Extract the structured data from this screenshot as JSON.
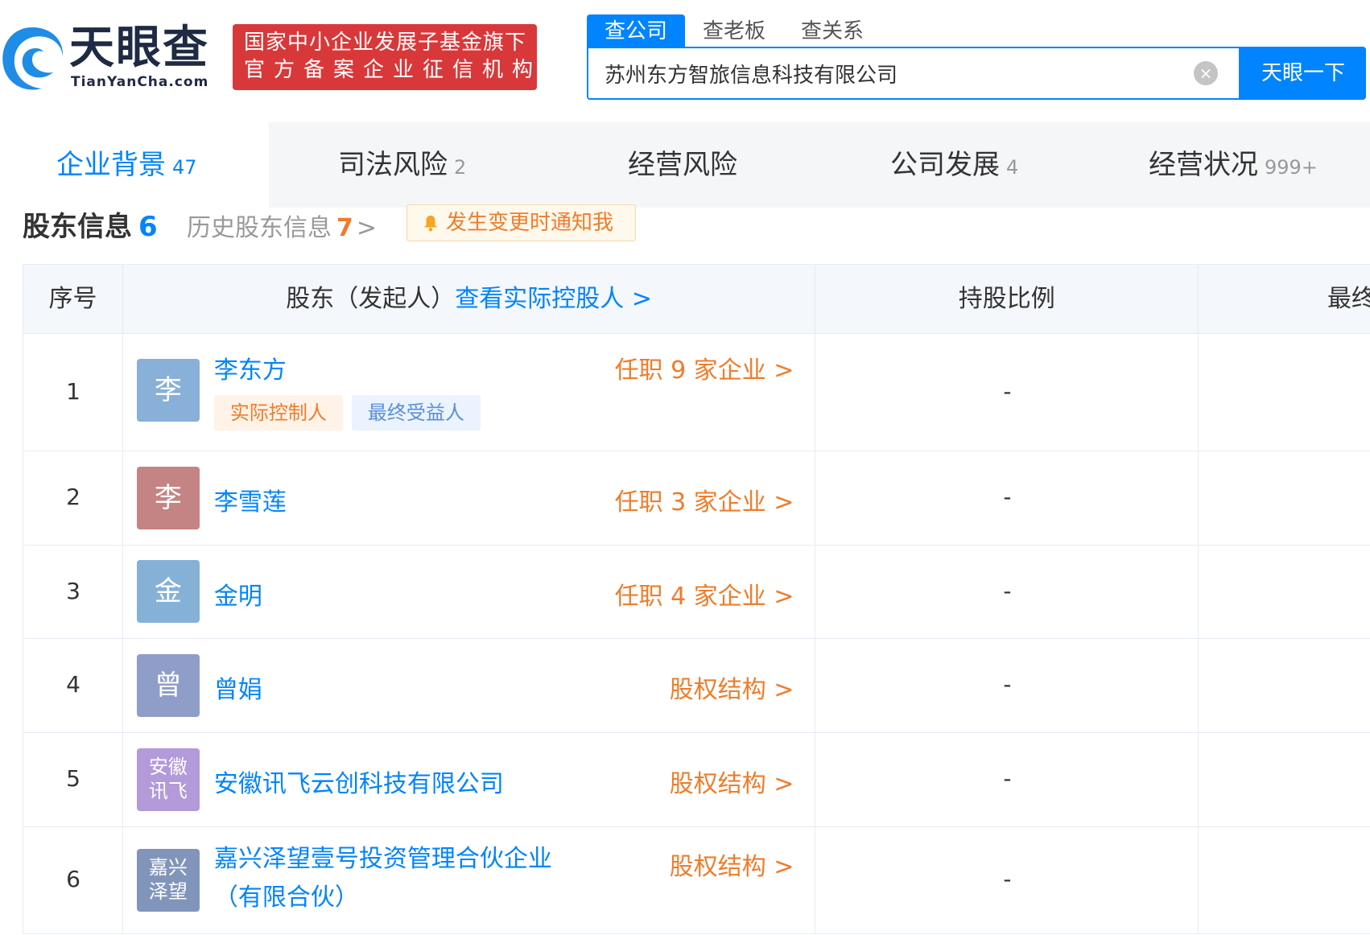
{
  "header": {
    "logo_text": "天眼查",
    "logo_sub": "TianYanCha.com",
    "badge_line1": "国家中小企业发展子基金旗下",
    "badge_line2": "官方备案企业征信机构",
    "search_tabs": [
      "查公司",
      "查老板",
      "查关系"
    ],
    "search_value": "苏州东方智旅信息科技有限公司",
    "search_button": "天眼一下",
    "clear_icon": "×"
  },
  "nav": [
    {
      "label": "企业背景",
      "count": "47"
    },
    {
      "label": "司法风险",
      "count": "2"
    },
    {
      "label": "经营风险",
      "count": ""
    },
    {
      "label": "公司发展",
      "count": "4"
    },
    {
      "label": "经营状况",
      "count": "999+"
    }
  ],
  "section": {
    "title": "股东信息",
    "count": "6",
    "history_label": "历史股东信息",
    "history_count": "7",
    "history_chevron": ">",
    "notify_label": "发生变更时通知我"
  },
  "table": {
    "headers": {
      "index": "序号",
      "holder": "股东（发起人）",
      "holder_link": "查看实际控股人 >",
      "ratio": "持股比例",
      "final": "最终受益股份"
    },
    "rows": [
      {
        "index": "1",
        "avatar": "李",
        "avatar_color": "#88b0d8",
        "name": "李东方",
        "tags": [
          "实际控制人",
          "最终受益人"
        ],
        "action": "任职 9 家企业 >",
        "ratio": "-"
      },
      {
        "index": "2",
        "avatar": "李",
        "avatar_color": "#c48483",
        "name": "李雪莲",
        "action": "任职 3 家企业 >",
        "ratio": "-"
      },
      {
        "index": "3",
        "avatar": "金",
        "avatar_color": "#85b1d7",
        "name": "金明",
        "action": "任职 4 家企业 >",
        "ratio": "-"
      },
      {
        "index": "4",
        "avatar": "曾",
        "avatar_color": "#8f9ec8",
        "name": "曾娟",
        "action": "股权结构 >",
        "ratio": "-"
      },
      {
        "index": "5",
        "avatar_line1": "安徽",
        "avatar_line2": "讯飞",
        "avatar_color": "#b39ad8",
        "name": "安徽讯飞云创科技有限公司",
        "action": "股权结构 >",
        "ratio": "-"
      },
      {
        "index": "6",
        "avatar_line1": "嘉兴",
        "avatar_line2": "泽望",
        "avatar_color": "#8195bb",
        "name_line1": "嘉兴泽望壹号投资管理合伙企业",
        "name_line2": "（有限合伙）",
        "action": "股权结构 >",
        "ratio": "-"
      }
    ]
  }
}
